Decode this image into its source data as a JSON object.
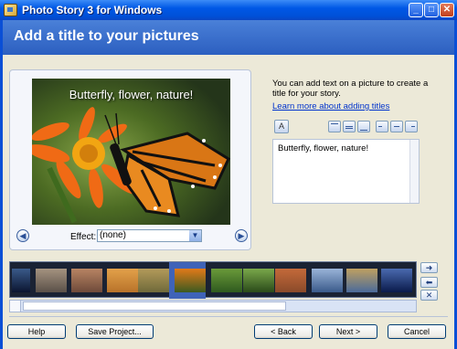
{
  "window": {
    "title": "Photo Story 3 for Windows"
  },
  "header": {
    "title": "Add a title to your pictures"
  },
  "preview": {
    "overlay_text": "Butterfly, flower, nature!",
    "effect_label": "Effect:",
    "effect_value": "(none)"
  },
  "right_panel": {
    "intro": "You can add text on a picture to create a title for your story.",
    "link": "Learn more about adding titles",
    "text_value": "Butterfly, flower, nature!"
  },
  "filmstrip": {
    "thumbnails": [
      {
        "desc": "night-lake"
      },
      {
        "desc": "street-scene"
      },
      {
        "desc": "brick-building"
      },
      {
        "desc": "tiger"
      },
      {
        "desc": "deer"
      },
      {
        "desc": "monarch-butterfly"
      },
      {
        "desc": "leaves"
      },
      {
        "desc": "green-plant"
      },
      {
        "desc": "brick-facade"
      },
      {
        "desc": "city-skyline"
      },
      {
        "desc": "castle"
      },
      {
        "desc": "dusk-sky"
      }
    ],
    "selected_index": 5
  },
  "buttons": {
    "help": "Help",
    "save": "Save Project...",
    "back": "< Back",
    "next": "Next >",
    "cancel": "Cancel"
  },
  "colors": {
    "titlebar": "#0058e6",
    "header": "#2c5fc0",
    "link": "#0033cc"
  }
}
